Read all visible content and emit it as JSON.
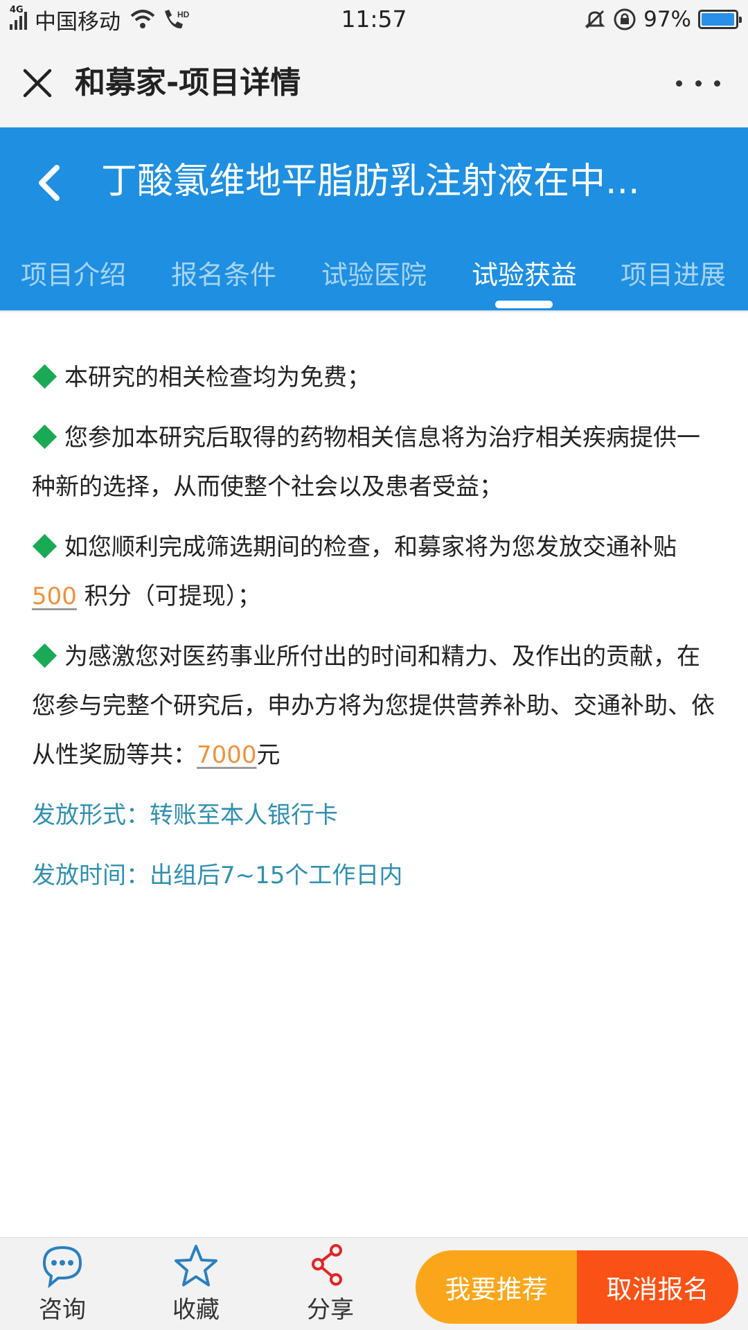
{
  "status_bar": {
    "network": "4G",
    "carrier": "中国移动",
    "time": "11:57",
    "battery": "97%",
    "battery_level": 0.97,
    "icons": [
      "signal-icon",
      "wifi-icon",
      "hd-call-icon",
      "mute-bell-icon",
      "rotation-lock-icon",
      "battery-icon"
    ]
  },
  "webview": {
    "title": "和募家-项目详情",
    "icons": {
      "close": "close-icon",
      "more": "more-icon"
    }
  },
  "header": {
    "title": "丁酸氯维地平脂肪乳注射液在中...",
    "accent_color": "#1e8fe1",
    "tabs": [
      {
        "label": "项目介绍",
        "active": false
      },
      {
        "label": "报名条件",
        "active": false
      },
      {
        "label": "试验医院",
        "active": false
      },
      {
        "label": "试验获益",
        "active": true
      },
      {
        "label": "项目进展",
        "active": false
      }
    ]
  },
  "content": {
    "bullet_color": "#1aaa55",
    "highlight_color": "#f0913a",
    "info_color": "#2f8fb0",
    "benefits": [
      {
        "text": "本研究的相关检查均为免费；"
      },
      {
        "text": "您参加本研究后取得的药物相关信息将为治疗相关疾病提供一种新的选择，从而使整个社会以及患者受益；"
      },
      {
        "before": "如您顺利完成筛选期间的检查，和募家将为您发放交通补贴",
        "amount": "500",
        "after": "积分（可提现）；"
      },
      {
        "before": "为感激您对医药事业所付出的时间和精力、及作出的贡献，在您参与完整个研究后，申办方将为您提供营养补助、交通补助、依从性奖励等共：",
        "amount": "7000",
        "after": "元"
      }
    ],
    "payment_method": "发放形式：转账至本人银行卡",
    "payment_time": "发放时间：出组后7~15个工作日内"
  },
  "bottom_bar": {
    "items": [
      {
        "label": "咨询",
        "icon": "chat-bubble-icon"
      },
      {
        "label": "收藏",
        "icon": "star-icon"
      },
      {
        "label": "分享",
        "icon": "share-icon"
      }
    ],
    "recommend_button": "我要推荐",
    "cancel_button": "取消报名",
    "recommend_color": "#fba61a",
    "cancel_color": "#fa5216"
  }
}
